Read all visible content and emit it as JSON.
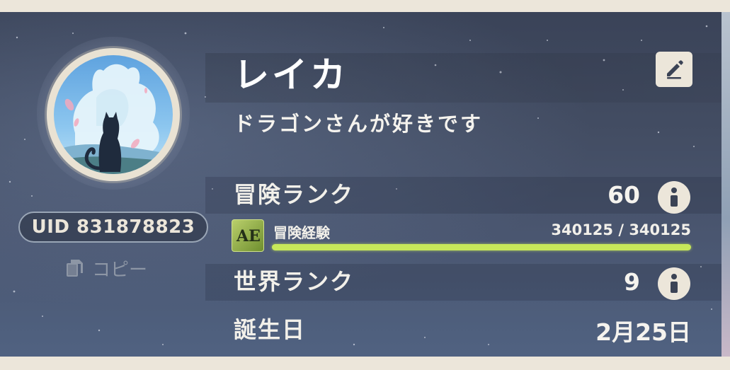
{
  "profile": {
    "name": "レイカ",
    "signature": "ドラゴンさんが好きです",
    "uid": "UID 831878823",
    "copy_label": "コピー"
  },
  "stats": {
    "adventure_rank_label": "冒険ランク",
    "adventure_rank_value": "60",
    "adventure_exp_label": "冒険経験",
    "adventure_exp_value": "340125 / 340125",
    "adventure_exp_fraction": 1.0,
    "world_level_label": "世界ランク",
    "world_level_value": "9",
    "birthday_label": "誕生日",
    "birthday_value": "2月25日"
  },
  "colors": {
    "panel": "#434d63",
    "cream": "#ece6da",
    "exp_bar": "#c7e85a"
  },
  "icons": [
    "edit-icon",
    "info-icon",
    "copy-icon",
    "adventure-exp-icon"
  ]
}
